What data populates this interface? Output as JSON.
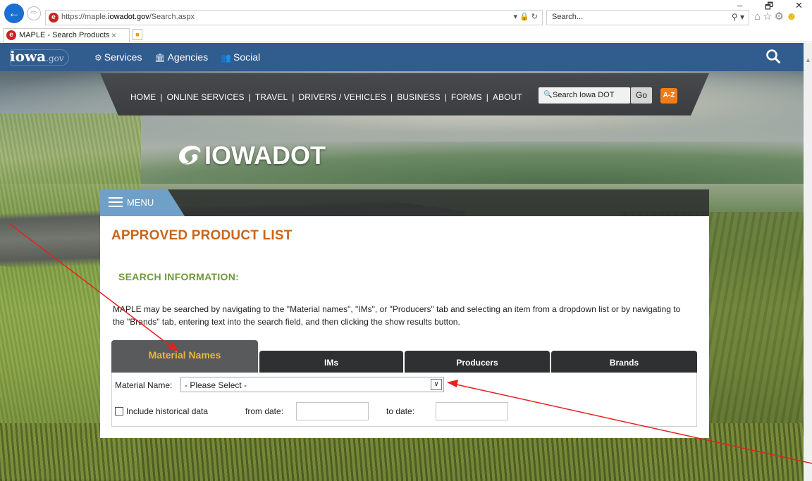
{
  "browser": {
    "url_prefix": "https://maple.",
    "url_domain": "iowadot.gov",
    "url_path": "/Search.aspx",
    "addr_controls": "▾ 🔒 ↻",
    "search_placeholder": "Search...",
    "search_controls": "⚲ ▾",
    "tab_title": "MAPLE - Search Products",
    "window_controls": [
      "–",
      "🗗",
      "✕"
    ]
  },
  "iowa_nav": {
    "logo_main": "iowa",
    "logo_suffix": ".gov",
    "links": [
      {
        "icon": "⚙",
        "label": "Services"
      },
      {
        "icon": "🏛",
        "label": "Agencies"
      },
      {
        "icon": "👥",
        "label": "Social"
      }
    ]
  },
  "dot_nav": {
    "links": [
      "HOME",
      "ONLINE SERVICES",
      "TRAVEL",
      "DRIVERS / VEHICLES",
      "BUSINESS",
      "FORMS",
      "ABOUT"
    ],
    "separator": "|",
    "search_placeholder": "Search Iowa DOT",
    "go_label": "Go",
    "az_label": "A-Z"
  },
  "logo_text": "IOWADOT",
  "menu_label": "MENU",
  "page": {
    "title": "APPROVED PRODUCT LIST",
    "section_title": "SEARCH INFORMATION:",
    "description": "MAPLE may be searched by navigating to the \"Material names\", \"IMs\", or \"Producers\" tab and selecting an item from a dropdown list or by navigating to the \"Brands\" tab, entering text into the search field, and then clicking the show results button."
  },
  "tabs": [
    "Material Names",
    "IMs",
    "Producers",
    "Brands"
  ],
  "form": {
    "material_label": "Material Name:",
    "material_value": "- Please Select -",
    "historical_label": "Include historical data",
    "from_label": "from date:",
    "to_label": "to date:"
  },
  "colors": {
    "iowa_blue": "#305d8e",
    "title_orange": "#c8661a",
    "section_green": "#6f9a3a",
    "tab_gold": "#e8b938",
    "az_orange": "#f07d1a",
    "annotation_red": "#e8201e"
  }
}
